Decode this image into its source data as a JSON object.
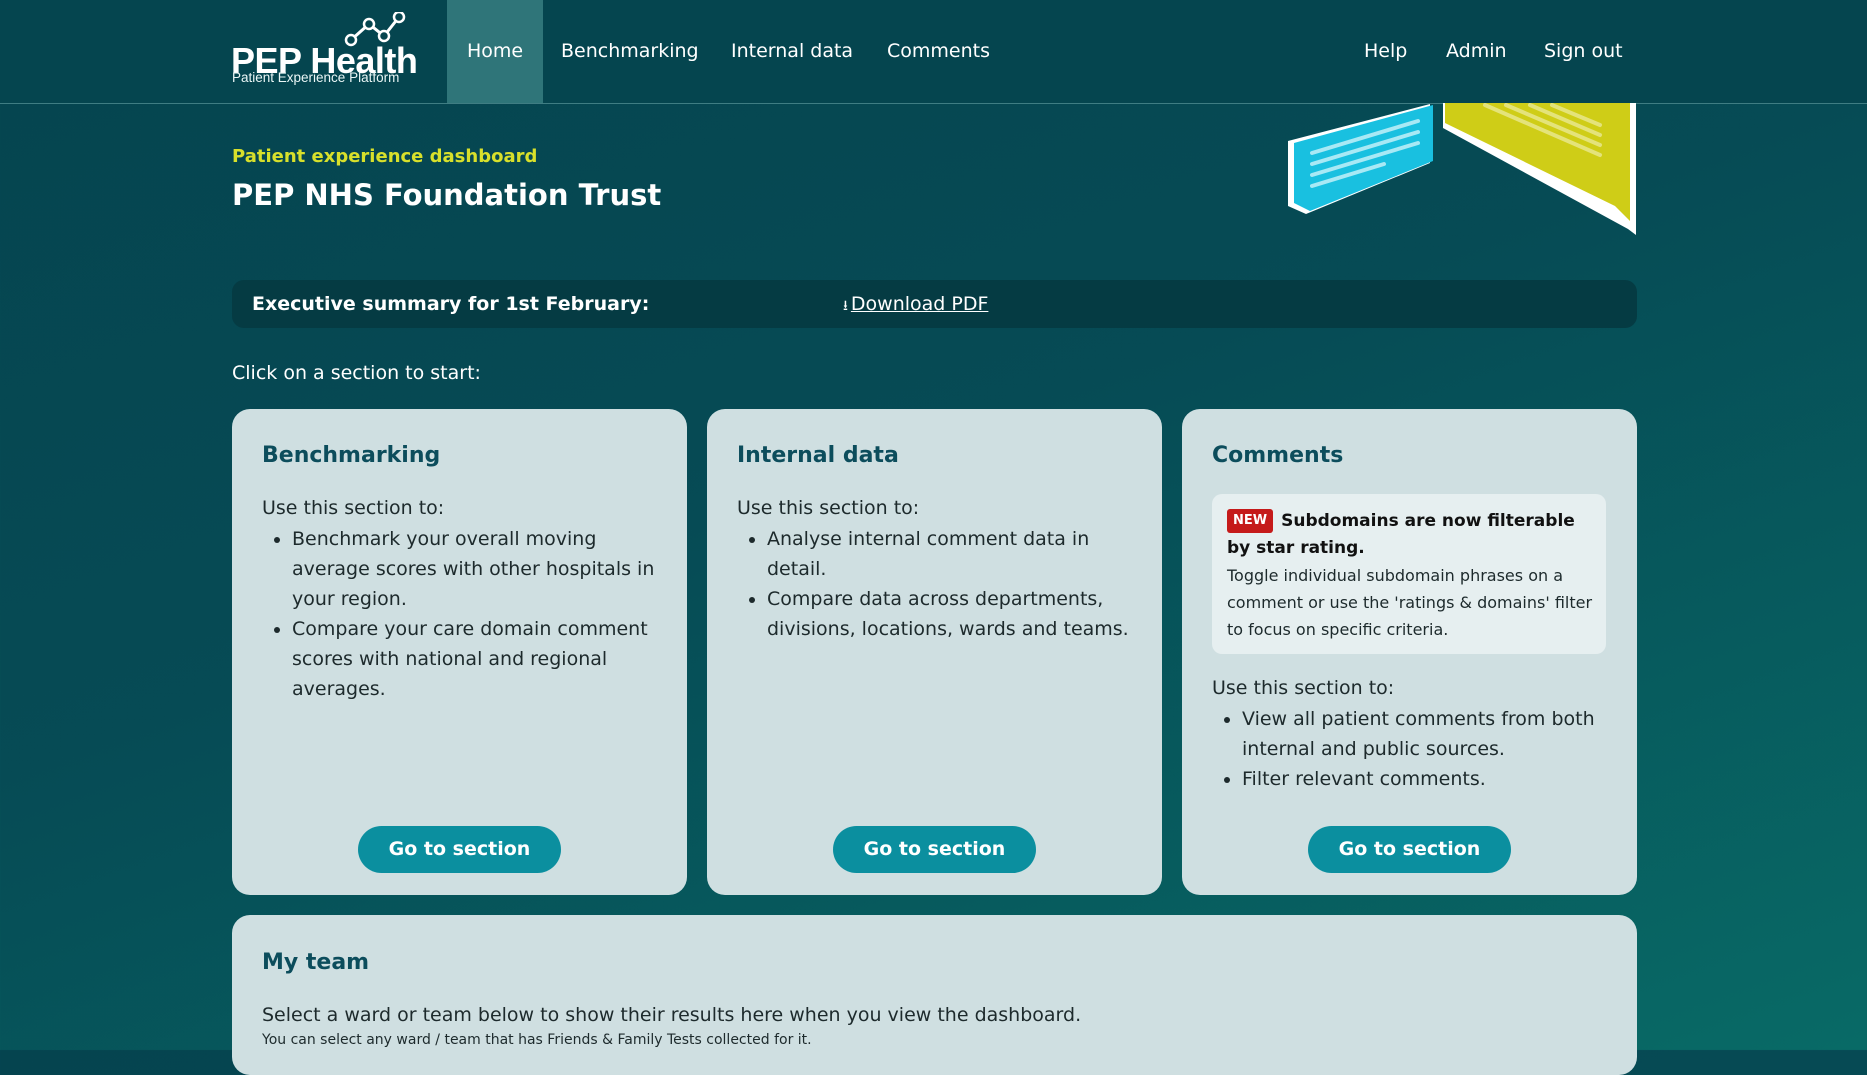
{
  "brand": {
    "name": "PEP Health",
    "tagline": "Patient Experience Platform"
  },
  "nav": {
    "home": "Home",
    "benchmarking": "Benchmarking",
    "internal_data": "Internal data",
    "comments": "Comments",
    "help": "Help",
    "admin": "Admin",
    "sign_out": "Sign out"
  },
  "header": {
    "eyebrow": "Patient experience dashboard",
    "title": "PEP NHS Foundation Trust"
  },
  "summary": {
    "label": "Executive summary for 1st February:",
    "link": "Download PDF",
    "icon": "download-icon"
  },
  "prompt": "Click on a section to start:",
  "cards": {
    "benchmarking": {
      "title": "Benchmarking",
      "intro": "Use this section to:",
      "bullets": [
        "Benchmark your overall moving average scores with other hospitals in your region.",
        "Compare your care domain comment scores with national and regional averages."
      ],
      "button": "Go to section"
    },
    "internal": {
      "title": "Internal data",
      "intro": "Use this section to:",
      "bullets": [
        "Analyse internal comment data in detail.",
        "Compare data across departments, divisions, locations, wards and teams."
      ],
      "button": "Go to section"
    },
    "comments": {
      "title": "Comments",
      "new_badge": "NEW",
      "new_title": "Subdomains are now filterable by star rating.",
      "new_desc": "Toggle individual subdomain phrases on a comment or use the 'ratings & domains' filter to focus on specific criteria.",
      "intro": "Use this section to:",
      "bullets": [
        "View all patient comments from both internal and public sources.",
        "Filter relevant comments."
      ],
      "button": "Go to section"
    }
  },
  "team": {
    "title": "My team",
    "description": "Select a ward or team below to show their results here when you view the dashboard.",
    "note": "You can select any ward / team that has Friends & Family Tests collected for it."
  },
  "colors": {
    "background": "#05444f",
    "accent_yellow": "#d8e02b",
    "card_bg": "#cfdfe1",
    "button": "#0b8f9f",
    "heading": "#0c4d5c",
    "badge_red": "#c51a1a",
    "bubble_blue": "#19c0e0",
    "bubble_yellow": "#cfcd17"
  }
}
